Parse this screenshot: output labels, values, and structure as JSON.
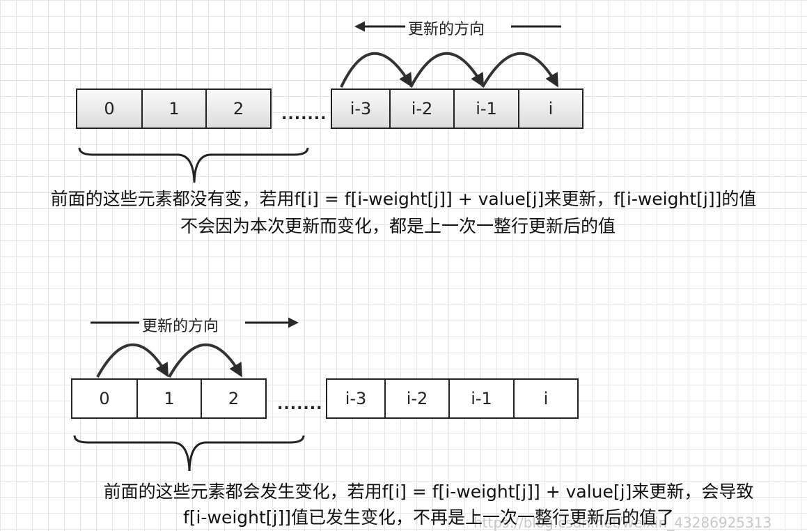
{
  "top": {
    "direction_label": "更新的方向",
    "cells_left": [
      "0",
      "1",
      "2"
    ],
    "ellipsis": ".......",
    "cells_right": [
      "i-3",
      "i-2",
      "i-1",
      "i"
    ],
    "caption_line1": "前面的这些元素都没有变，若用f[i] = f[i-weight[j]] + value[j]来更新，f[i-weight[j]]的值",
    "caption_line2": "不会因为本次更新而变化，都是上一次一整行更新后的值"
  },
  "bottom": {
    "direction_label": "更新的方向",
    "cells_left": [
      "0",
      "1",
      "2"
    ],
    "ellipsis": ".......",
    "cells_right": [
      "i-3",
      "i-2",
      "i-1",
      "i"
    ],
    "caption_line1": "前面的这些元素都会发生变化，若用f[i] = f[i-weight[j]] + value[j]来更新，会导致",
    "caption_line2": "f[i-weight[j]]值已发生变化，不再是上一次一整行更新后的值了"
  },
  "watermark": "https://blog.csdn.net/weixin_43286925313",
  "colors": {
    "stroke": "#222222",
    "grid": "#e6e6e6",
    "cell_gradient_top": "#fafafa",
    "cell_gradient_bottom": "#dcdcdc"
  }
}
